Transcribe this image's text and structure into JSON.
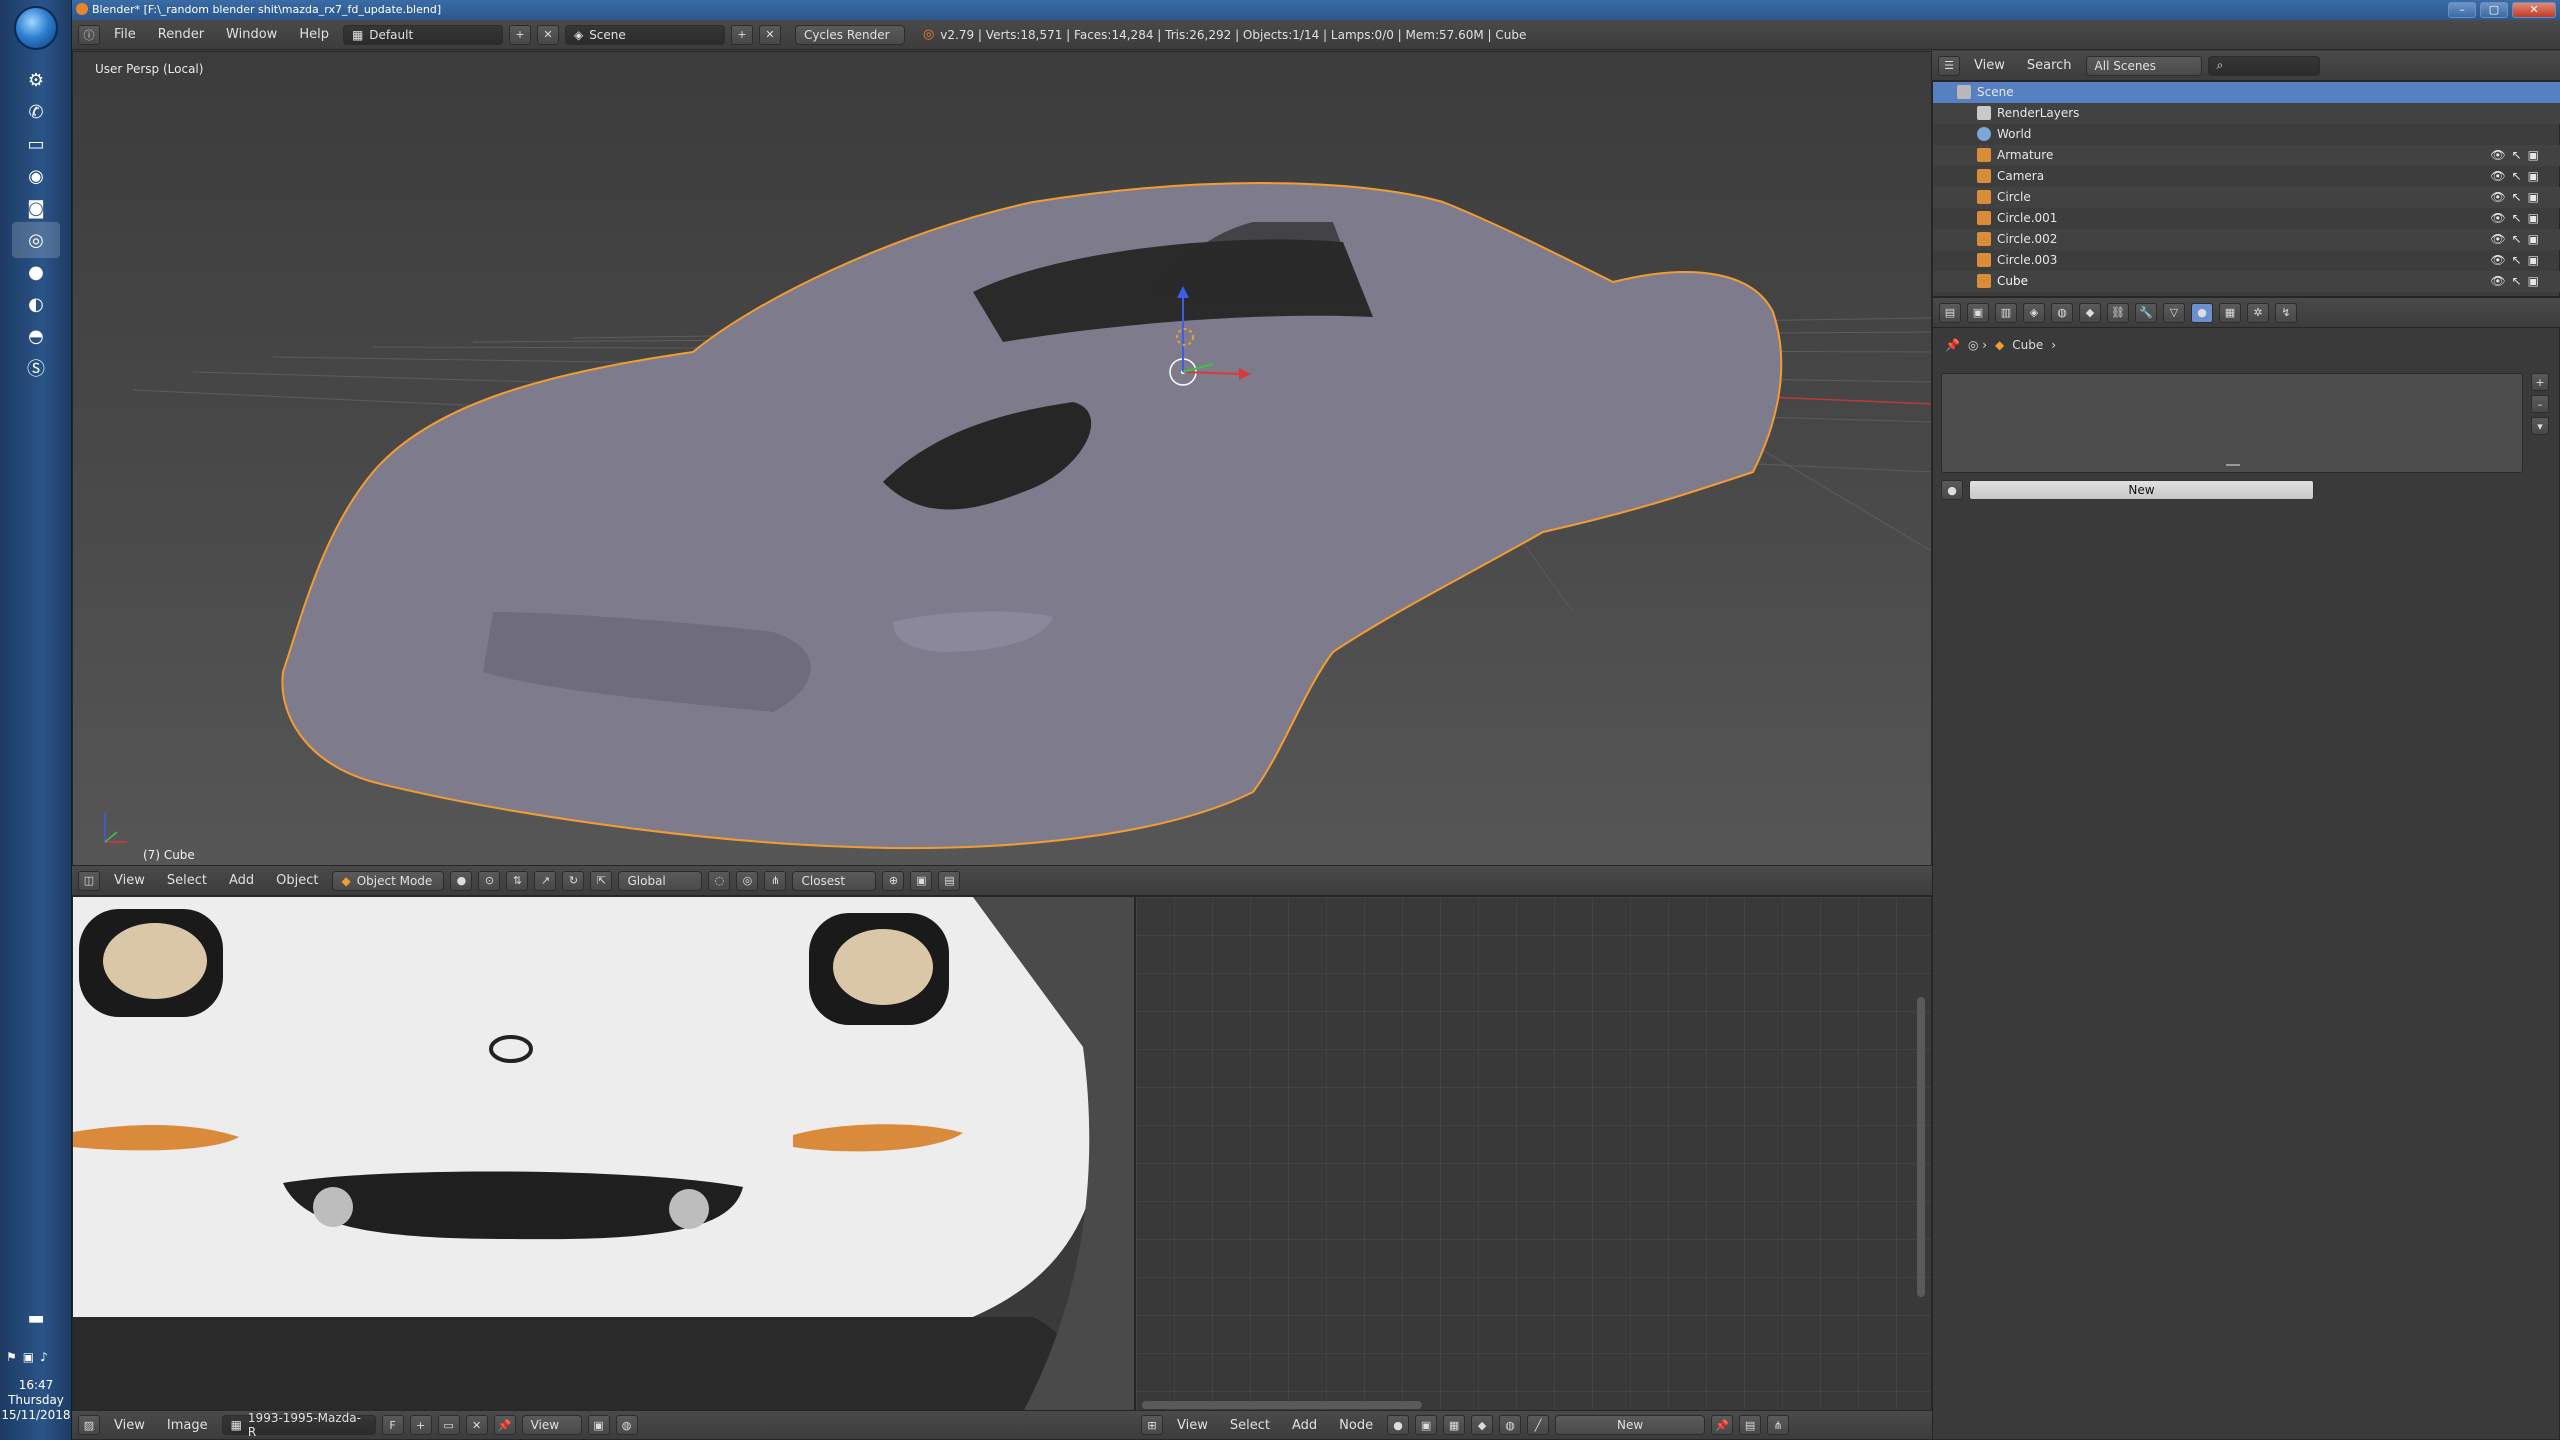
{
  "taskbar": {
    "clock_time": "16:47",
    "clock_day": "Thursday",
    "clock_date": "15/11/2018"
  },
  "window": {
    "title": "Blender* [F:\\_random blender shit\\mazda_rx7_fd_update.blend]"
  },
  "info_header": {
    "menus": [
      "File",
      "Render",
      "Window",
      "Help"
    ],
    "layout": "Default",
    "scene": "Scene",
    "engine": "Cycles Render",
    "stats": "v2.79 | Verts:18,571 | Faces:14,284 | Tris:26,292 | Objects:1/14 | Lamps:0/0 | Mem:57.60M | Cube"
  },
  "viewport": {
    "view_label": "User Persp (Local)",
    "object_label": "(7) Cube",
    "menus": [
      "View",
      "Select",
      "Add",
      "Object"
    ],
    "mode": "Object Mode",
    "orientation": "Global",
    "snap": "Closest"
  },
  "outliner": {
    "menus": [
      "View",
      "Search"
    ],
    "filter": "All Scenes",
    "rows": [
      {
        "label": "Scene",
        "icon_color": "#b9b9b9"
      },
      {
        "label": "RenderLayers",
        "icon_color": "#c9c9c9"
      },
      {
        "label": "World",
        "icon_color": "#7aa6d8"
      },
      {
        "label": "Armature",
        "icon_color": "#d98c3a"
      },
      {
        "label": "Camera",
        "icon_color": "#d98c3a"
      },
      {
        "label": "Circle",
        "icon_color": "#d98c3a"
      },
      {
        "label": "Circle.001",
        "icon_color": "#d98c3a"
      },
      {
        "label": "Circle.002",
        "icon_color": "#d98c3a"
      },
      {
        "label": "Circle.003",
        "icon_color": "#d98c3a"
      },
      {
        "label": "Cube",
        "icon_color": "#d98c3a"
      }
    ]
  },
  "properties": {
    "breadcrumb_object": "Cube",
    "new_button": "New"
  },
  "image_editor": {
    "menus": [
      "View",
      "Image"
    ],
    "image_name": "1993-1995-Mazda-R",
    "view_menu": "View"
  },
  "node_editor": {
    "menus": [
      "View",
      "Select",
      "Add",
      "Node"
    ],
    "new_button": "New"
  }
}
